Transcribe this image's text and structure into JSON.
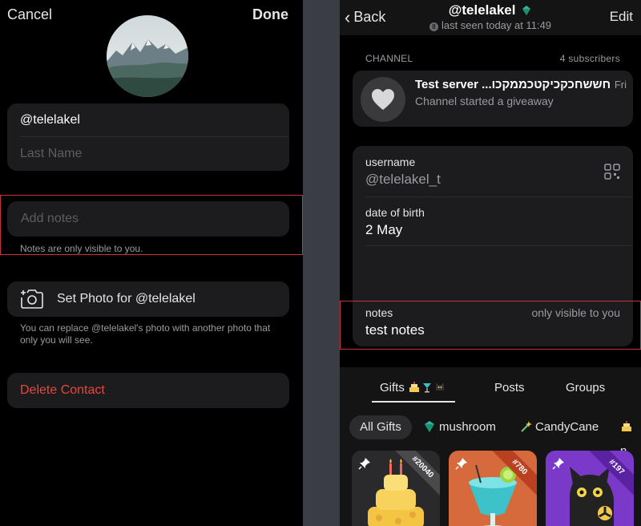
{
  "left": {
    "cancel_label": "Cancel",
    "done_label": "Done",
    "first_name": "@telelakel",
    "last_name_placeholder": "Last Name",
    "notes_placeholder": "Add notes",
    "notes_hint": "Notes are only visible to you.",
    "set_photo_label": "Set Photo for @telelakel",
    "photo_hint": "You can replace @telelakel's photo with another photo that only you will see.",
    "delete_label": "Delete Contact"
  },
  "right": {
    "back_label": "Back",
    "title": "@telelakel",
    "status_badge": "8",
    "status": "last seen today at 11:49",
    "edit_label": "Edit",
    "channel_label": "CHANNEL",
    "subscribers": "4 subscribers",
    "channel": {
      "title": "Test server ...חששחכקכיקטכממקכו",
      "message": "Channel started a giveaway",
      "time": "Fri"
    },
    "info": {
      "username_label": "username",
      "username_value": "@telelakel_t",
      "dob_label": "date of birth",
      "dob_value": "2 May",
      "notes_label": "notes",
      "notes_visibility": "only visible to you",
      "notes_value": "test notes"
    },
    "tabs": [
      {
        "label": "Gifts"
      },
      {
        "label": "Posts"
      },
      {
        "label": "Groups"
      }
    ],
    "filters": [
      {
        "label": "All Gifts"
      },
      {
        "label": "mushroom"
      },
      {
        "label": "CandyCane"
      },
      {
        "label": "n"
      }
    ],
    "gifts": [
      {
        "number": "#20040",
        "icon": "cake-icon"
      },
      {
        "number": "#780",
        "icon": "cocktail-icon"
      },
      {
        "number": "#197",
        "icon": "black-cat-icon"
      }
    ]
  },
  "colors": {
    "highlight_border": "#c6333a",
    "destructive": "#e5483d",
    "card_bg": "#1c1c1e",
    "divider_bg": "#3a3d45"
  }
}
